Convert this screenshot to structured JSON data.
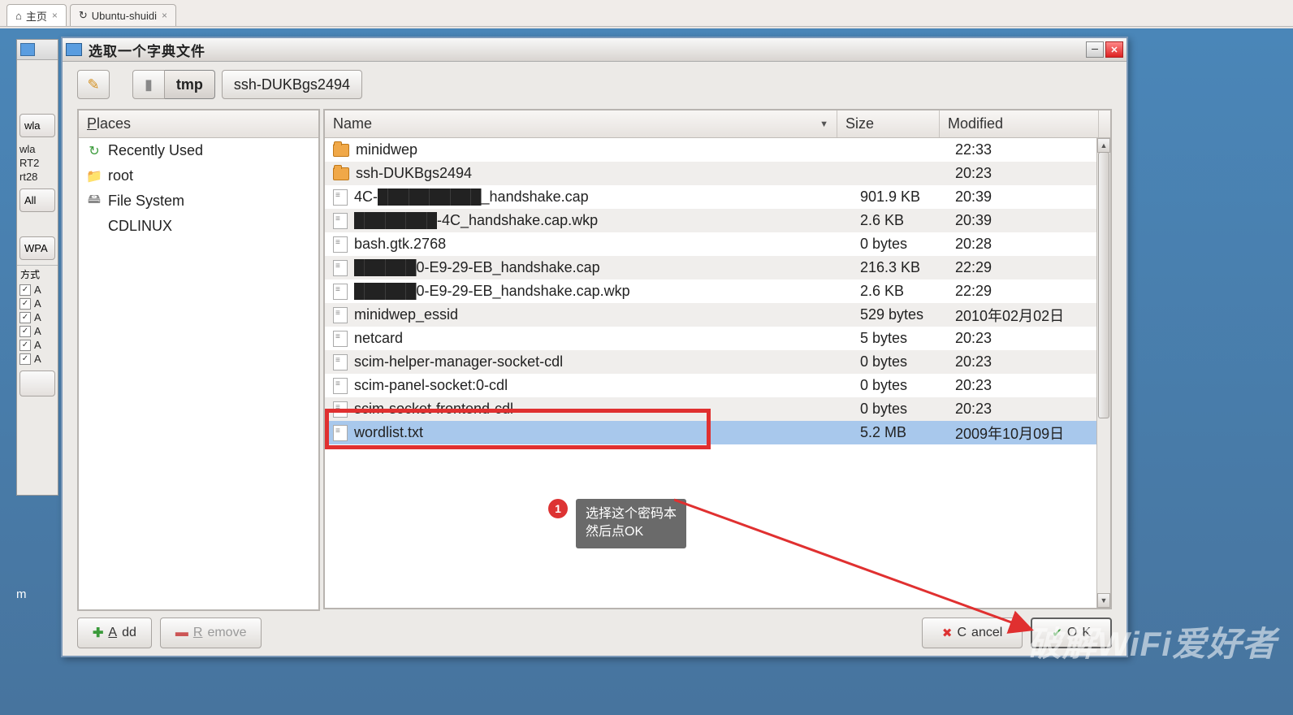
{
  "tabs": [
    {
      "icon": "⌂",
      "label": "主页"
    },
    {
      "icon": "↻",
      "label": "Ubuntu-shuidi"
    }
  ],
  "back": {
    "wlan_box": "wla",
    "items": [
      "wla",
      "RT2",
      "rt28"
    ],
    "all": "All",
    "wpa": "WPA",
    "fangshi": "方式",
    "checks": [
      "A",
      "A",
      "A",
      "A",
      "A",
      "A"
    ],
    "footer": "m"
  },
  "dialog": {
    "title": "选取一个字典文件",
    "path": {
      "root": "▮",
      "tmp": "tmp",
      "leaf": "ssh-DUKBgs2494"
    },
    "places_header": "Places",
    "places": [
      {
        "ico": "↻",
        "color": "#3a9a3a",
        "label": "Recently Used"
      },
      {
        "ico": "📁",
        "color": "#3a6dc0",
        "label": "root"
      },
      {
        "ico": "🖴",
        "color": "#888",
        "label": "File System"
      },
      {
        "ico": "",
        "color": "#888",
        "label": "CDLINUX"
      }
    ],
    "cols": {
      "name": "Name",
      "size": "Size",
      "modified": "Modified"
    },
    "files": [
      {
        "t": "d",
        "name": "minidwep",
        "size": "",
        "mod": "22:33"
      },
      {
        "t": "d",
        "name": "ssh-DUKBgs2494",
        "size": "",
        "mod": "20:23"
      },
      {
        "t": "f",
        "name": "4C-██████████_handshake.cap",
        "size": "901.9 KB",
        "mod": "20:39"
      },
      {
        "t": "f",
        "name": "████████-4C_handshake.cap.wkp",
        "size": "2.6 KB",
        "mod": "20:39"
      },
      {
        "t": "f",
        "name": "bash.gtk.2768",
        "size": "0 bytes",
        "mod": "20:28"
      },
      {
        "t": "f",
        "name": "██████0-E9-29-EB_handshake.cap",
        "size": "216.3 KB",
        "mod": "22:29"
      },
      {
        "t": "f",
        "name": "██████0-E9-29-EB_handshake.cap.wkp",
        "size": "2.6 KB",
        "mod": "22:29"
      },
      {
        "t": "f",
        "name": "minidwep_essid",
        "size": "529 bytes",
        "mod": "2010年02月02日"
      },
      {
        "t": "f",
        "name": "netcard",
        "size": "5 bytes",
        "mod": "20:23"
      },
      {
        "t": "f",
        "name": "scim-helper-manager-socket-cdl",
        "size": "0 bytes",
        "mod": "20:23"
      },
      {
        "t": "f",
        "name": "scim-panel-socket:0-cdl",
        "size": "0 bytes",
        "mod": "20:23"
      },
      {
        "t": "f",
        "name": "scim-socket-frontend-cdl",
        "size": "0 bytes",
        "mod": "20:23"
      },
      {
        "t": "f",
        "name": "wordlist.txt",
        "size": "5.2 MB",
        "mod": "2009年10月09日",
        "sel": true
      }
    ],
    "annotation": {
      "num": "1",
      "line1": "选择这个密码本",
      "line2": "然后点OK"
    },
    "add": "Add",
    "remove": "Remove",
    "cancel": "Cancel",
    "ok": "OK"
  },
  "watermark": "破解WiFi爱好者"
}
